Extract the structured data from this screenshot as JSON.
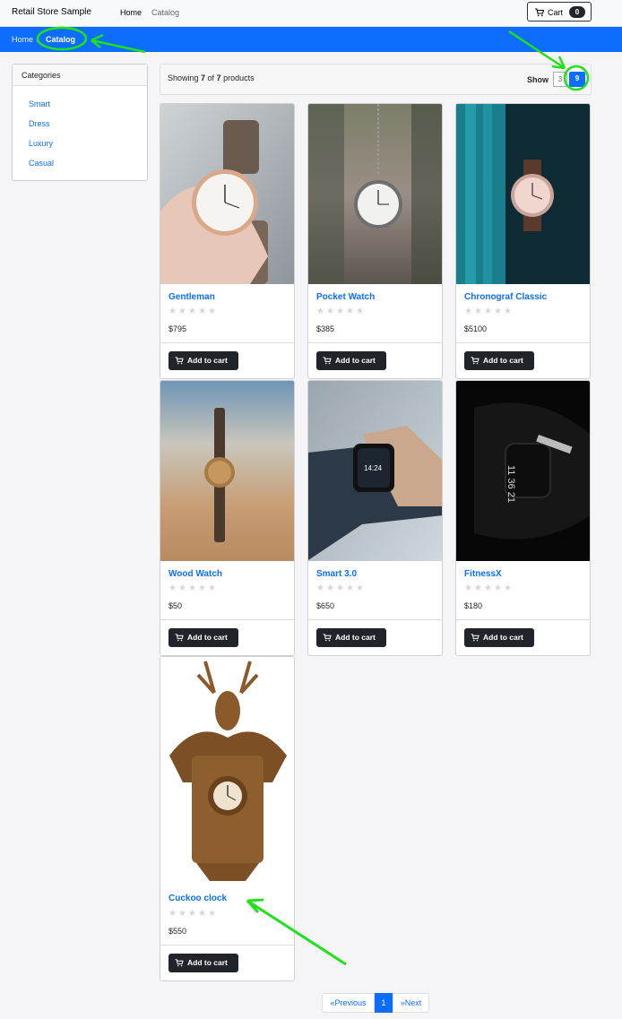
{
  "header": {
    "brand": "Retail Store Sample",
    "nav": [
      "Home",
      "Catalog"
    ],
    "cart_label": "Cart",
    "cart_count": "0"
  },
  "breadcrumb": {
    "home": "Home",
    "current": "Catalog"
  },
  "categories": {
    "title": "Categories",
    "items": [
      "Smart",
      "Dress",
      "Luxury",
      "Casual"
    ]
  },
  "toolbar": {
    "showing_prefix": "Showing ",
    "shown": "7",
    "of_word": " of ",
    "total": "7",
    "suffix": " products",
    "show_label": "Show",
    "page_size_options": [
      "3",
      "9"
    ],
    "page_size_selected": "9"
  },
  "products": [
    {
      "name": "Gentleman",
      "price": "$795",
      "rating": 0,
      "button": "Add to cart"
    },
    {
      "name": "Pocket Watch",
      "price": "$385",
      "rating": 0,
      "button": "Add to cart"
    },
    {
      "name": "Chronograf Classic",
      "price": "$5100",
      "rating": 0,
      "button": "Add to cart"
    },
    {
      "name": "Wood Watch",
      "price": "$50",
      "rating": 0,
      "button": "Add to cart"
    },
    {
      "name": "Smart 3.0",
      "price": "$650",
      "rating": 0,
      "button": "Add to cart"
    },
    {
      "name": "FitnessX",
      "price": "$180",
      "rating": 0,
      "button": "Add to cart"
    },
    {
      "name": "Cuckoo clock",
      "price": "$550",
      "rating": 0,
      "button": "Add to cart"
    }
  ],
  "pagination": {
    "prev": "«Previous",
    "current": "1",
    "next": "»Next"
  },
  "colors": {
    "primary": "#0d6efd",
    "dark": "#212529",
    "annotation": "#22e01a"
  }
}
